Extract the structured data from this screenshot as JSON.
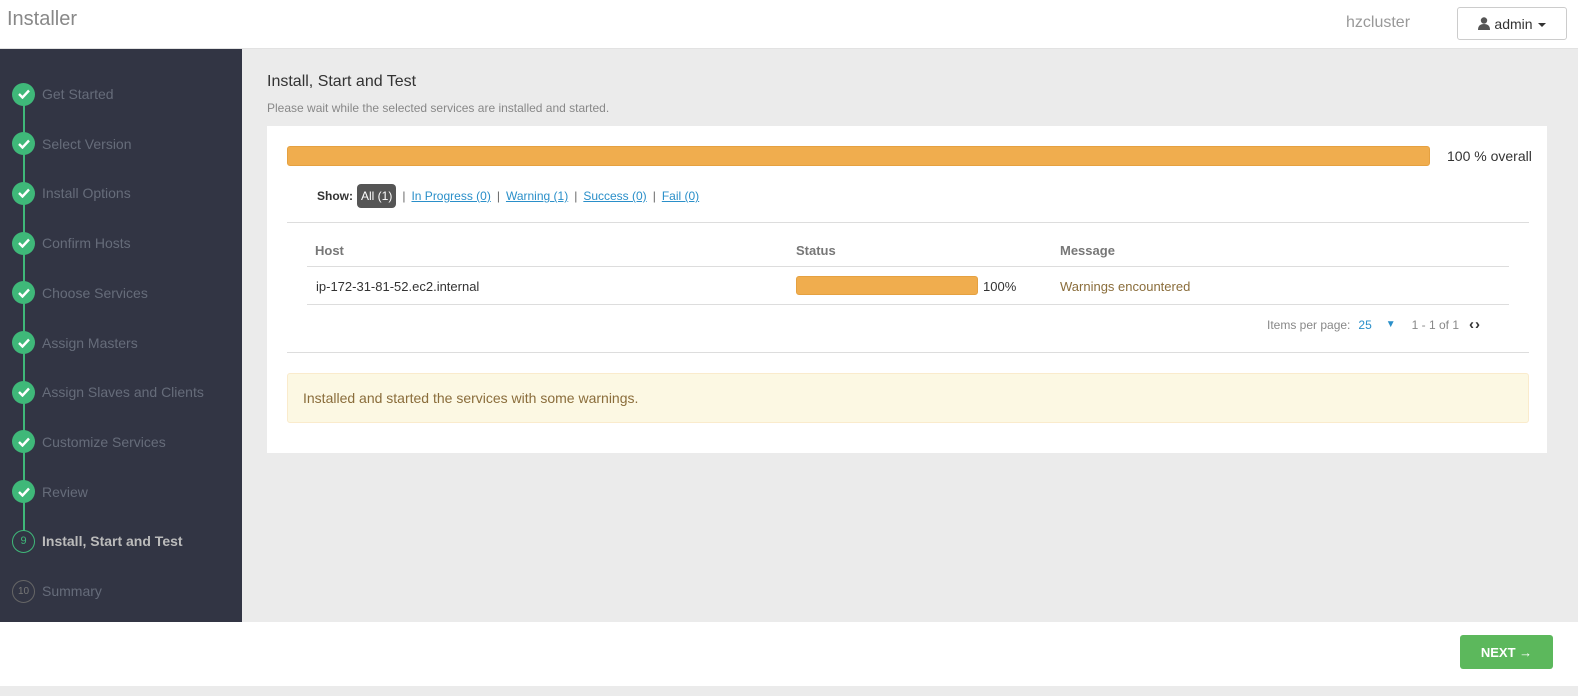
{
  "header": {
    "app_title": "Installer",
    "cluster_name": "hzcluster",
    "user_label": "admin"
  },
  "sidebar": {
    "steps": [
      {
        "label": "Get Started",
        "state": "done"
      },
      {
        "label": "Select Version",
        "state": "done"
      },
      {
        "label": "Install Options",
        "state": "done"
      },
      {
        "label": "Confirm Hosts",
        "state": "done"
      },
      {
        "label": "Choose Services",
        "state": "done"
      },
      {
        "label": "Assign Masters",
        "state": "done"
      },
      {
        "label": "Assign Slaves and Clients",
        "state": "done"
      },
      {
        "label": "Customize Services",
        "state": "done"
      },
      {
        "label": "Review",
        "state": "done"
      },
      {
        "label": "Install, Start and Test",
        "state": "current",
        "number": "9"
      },
      {
        "label": "Summary",
        "state": "future",
        "number": "10"
      }
    ]
  },
  "main": {
    "title": "Install, Start and Test",
    "subtitle": "Please wait while the selected services are installed and started.",
    "overall_progress": 100,
    "overall_text": "100 % overall",
    "filter": {
      "show_label": "Show:",
      "all": "All (1)",
      "in_progress": "In Progress (0)",
      "warning": "Warning (1)",
      "success": "Success (0)",
      "fail": "Fail (0)"
    },
    "table": {
      "headers": {
        "host": "Host",
        "status": "Status",
        "message": "Message"
      },
      "rows": [
        {
          "host": "ip-172-31-81-52.ec2.internal",
          "progress": 100,
          "percent": "100%",
          "message": "Warnings encountered"
        }
      ]
    },
    "pager": {
      "items_label": "Items per page:",
      "items_value": "25",
      "range": "1 - 1 of 1"
    },
    "alert": "Installed and started the services with some warnings."
  },
  "footer": {
    "next_label": "NEXT →"
  },
  "colors": {
    "progress": "#f0ad4e",
    "step_done": "#3fb879",
    "sidebar_bg": "#323544",
    "next_button": "#5cb85c"
  }
}
